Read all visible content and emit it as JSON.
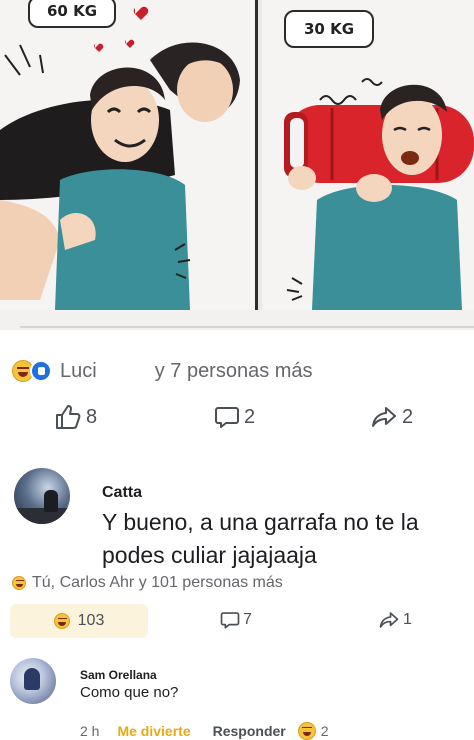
{
  "comic": {
    "left_bubble": "60 KG",
    "right_bubble": "30 KG"
  },
  "post": {
    "reactions": {
      "icons": [
        "haha-reaction-icon",
        "like-reaction-icon"
      ],
      "first_name": "Luci",
      "others": "y 7 personas más"
    },
    "likes": "8",
    "comments": "2",
    "shares": "2"
  },
  "comment": {
    "author": "Catta",
    "text": "Y bueno, a una garrafa no te la podes culiar jajajaaja",
    "reactors": "Tú, Carlos Ahr y 101 personas más",
    "haha_count": "103",
    "reply_count": "7",
    "share_count": "1"
  },
  "reply": {
    "author": "Sam Orellana",
    "text": "Como que no?",
    "time": "2 h",
    "reaction_label": "Me divierte",
    "reply_label": "Responder",
    "haha_count": "2"
  },
  "colors": {
    "accent_reaction": "#e6a817",
    "like_blue": "#1e6fe0",
    "pill_background": "#fbf3dc"
  }
}
